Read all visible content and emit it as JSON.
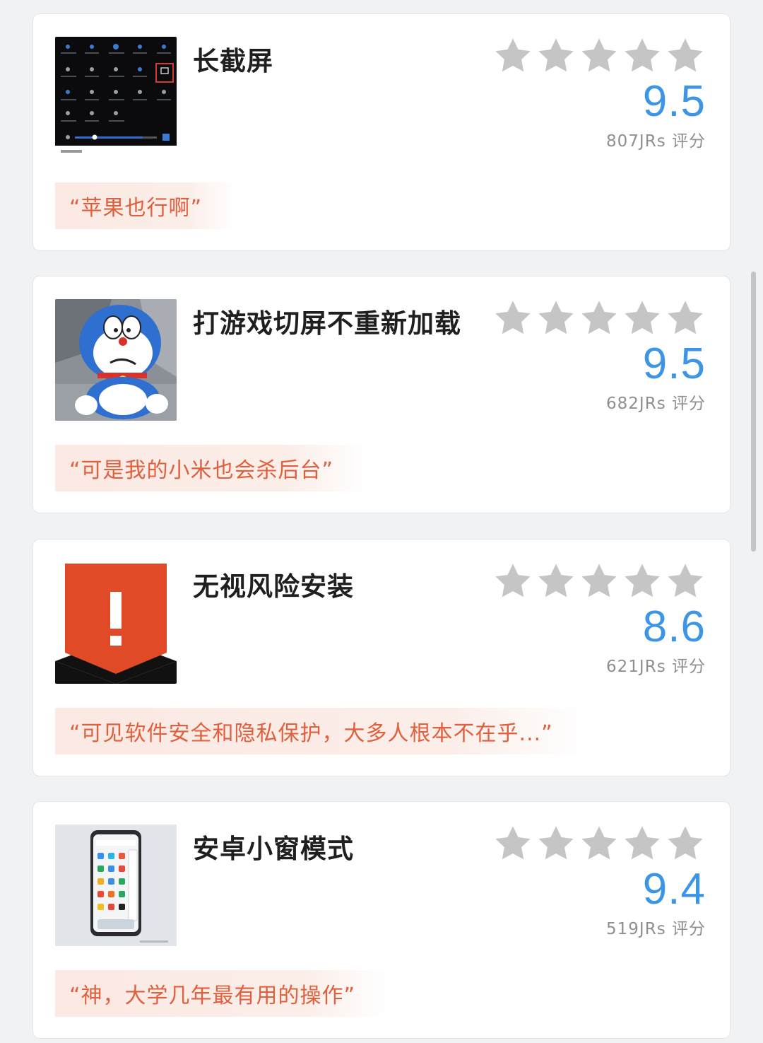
{
  "colors": {
    "accent": "#3d95e6",
    "star": "#c5c5c5",
    "quote_text": "#e0603e",
    "quote_bg": "#fbe9e3"
  },
  "items": [
    {
      "thumbnail": "control-center-screenshot",
      "title": "长截屏",
      "stars": 5,
      "score": "9.5",
      "votes": "807JRs 评分",
      "quote": "“苹果也行啊”"
    },
    {
      "thumbnail": "doraemon-meme",
      "title": "打游戏切屏不重新加载",
      "stars": 5,
      "score": "9.5",
      "votes": "682JRs 评分",
      "quote": "“可是我的小米也会杀后台”"
    },
    {
      "thumbnail": "warning-shield-icon",
      "title": "无视风险安装",
      "stars": 5,
      "score": "8.6",
      "votes": "621JRs 评分",
      "quote": "“可见软件安全和隐私保护，大多人根本不在乎...”"
    },
    {
      "thumbnail": "phone-floating-window",
      "title": "安卓小窗模式",
      "stars": 5,
      "score": "9.4",
      "votes": "519JRs 评分",
      "quote": "“神，大学几年最有用的操作”"
    }
  ]
}
